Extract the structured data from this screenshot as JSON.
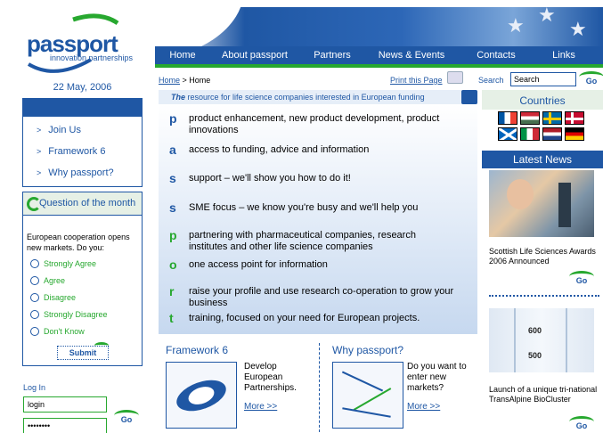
{
  "logo": {
    "word": "passport",
    "sub": "innovation partnerships"
  },
  "date": "22 May, 2006",
  "left_nav": [
    {
      "label": "Join Us"
    },
    {
      "label": "Framework 6"
    },
    {
      "label": "Why passport?"
    }
  ],
  "poll": {
    "title": "Question of the month",
    "question": "European cooperation opens new markets. Do you:",
    "options": [
      "Strongly Agree",
      "Agree",
      "Disagree",
      "Strongly Disagree",
      "Don't Know"
    ],
    "submit": "Submit"
  },
  "login": {
    "label": "Log In",
    "username_value": "login",
    "password_value": "••••••••",
    "go": "Go"
  },
  "nav": [
    "Home",
    "About passport",
    "Partners",
    "News & Events",
    "Contacts",
    "Links"
  ],
  "breadcrumb": {
    "home": "Home",
    "current": " > Home"
  },
  "print_label": "Print this Page",
  "search": {
    "label": "Search",
    "value": "Search",
    "go": "Go"
  },
  "tagline": {
    "bold": "The",
    "rest": " resource for life science companies interested in European funding"
  },
  "passport_rows": [
    {
      "letter": "p",
      "text": "product enhancement, new product development, product innovations"
    },
    {
      "letter": "a",
      "text": "access to funding, advice and information"
    },
    {
      "letter": "s",
      "text": "support – we'll show you how to do it!"
    },
    {
      "letter": "s",
      "text": "SME focus – we know you're busy and we'll help you"
    },
    {
      "letter": "p",
      "text": "partnering with pharmaceutical companies, research institutes and other life science companies"
    },
    {
      "letter": "o",
      "text": "one access point for information"
    },
    {
      "letter": "r",
      "text": "raise your profile and use research co-operation to grow your business"
    },
    {
      "letter": "t",
      "text": "training, focused on your need for European projects."
    }
  ],
  "features": [
    {
      "title": "Framework 6",
      "text": "Develop European Partnerships.",
      "more": "More >>"
    },
    {
      "title": "Why passport?",
      "text": "Do you want to enter new markets?",
      "more": "More >>"
    }
  ],
  "right": {
    "countries_title": "Countries",
    "latest_title": "Latest News",
    "news": [
      {
        "caption": "Scottish Life Sciences Awards 2006 Announced",
        "go": "Go"
      },
      {
        "caption": "Launch of a unique tri-national TransAlpine BioCluster",
        "go": "Go",
        "image_labels": [
          "600",
          "500"
        ]
      }
    ]
  },
  "colors": {
    "brand_blue": "#1f57a4",
    "brand_green": "#27a82f"
  }
}
